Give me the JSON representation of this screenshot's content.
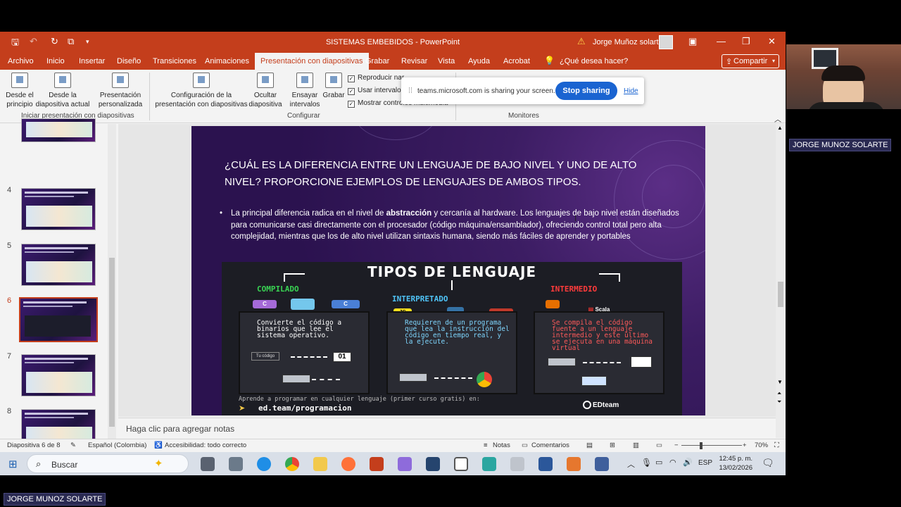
{
  "titlebar": {
    "title": "SISTEMAS EMBEBIDOS  -  PowerPoint",
    "user": "Jorge Muñoz solarte"
  },
  "menu": {
    "tabs": [
      "Archivo",
      "Inicio",
      "Insertar",
      "Diseño",
      "Transiciones",
      "Animaciones",
      "Presentación con diapositivas",
      "Grabar",
      "Revisar",
      "Vista",
      "Ayuda",
      "Acrobat",
      "¿Qué desea hacer?"
    ],
    "share": "Compartir"
  },
  "ribbon": {
    "desde_principio": "Desde el principio",
    "desde_actual": "Desde la diapositiva actual",
    "personalizada": "Presentación personalizada",
    "group_iniciar": "Iniciar presentación con diapositivas",
    "configuracion": "Configuración de la presentación con diapositivas",
    "ocultar": "Ocultar diapositiva",
    "ensayar": "Ensayar intervalos",
    "grabar": "Grabar",
    "chk_reproducir": "Reproducir nar",
    "chk_intervalos": "Usar intervalos",
    "chk_controles": "Mostrar controles multimedia",
    "group_configurar": "Configurar",
    "group_monitores": "Monitores"
  },
  "sharing": {
    "message": "teams.microsoft.com is sharing your screen.",
    "stop": "Stop sharing",
    "hide": "Hide"
  },
  "thumbnails": [
    "4",
    "5",
    "6",
    "7",
    "8"
  ],
  "slide": {
    "title": "¿CUÁL ES LA DIFERENCIA ENTRE UN LENGUAJE DE BAJO NIVEL Y UNO DE ALTO NIVEL? PROPORCIONE EJEMPLOS DE LENGUAJES DE AMBOS TIPOS.",
    "body_pre": "La principal diferencia radica en el nivel de ",
    "body_bold": "abstracción",
    "body_post": " y cercanía al hardware. Los lenguajes de bajo nivel están diseñados para comunicarse casi directamente con el procesador (código máquina/ensamblador), ofreciendo control total pero alta complejidad, mientras que los de alto nivel utilizan sintaxis humana, siendo más fáciles de aprender y portables"
  },
  "infographic": {
    "title": "TIPOS DE LENGUAJE",
    "compilado": {
      "title": "COMPILADO",
      "text": "Convierte el código a binarios que lee el sistema operativo.",
      "source_label": "Tu código",
      "binary": "01"
    },
    "interpretado": {
      "title": "INTERPRETADO",
      "text": "Requieren de un programa que lea la instrucción del código en tiempo real, y la ejecute.",
      "badge": "JS"
    },
    "intermedio": {
      "title": "INTERMEDIO",
      "text": "Se compila el código fuente a un lenguaje intermedio y este último se ejecuta en una máquina virtual",
      "badge": "Scala"
    },
    "footer": "Aprende a programar en cualquier lenguaje (primer curso gratis) en:",
    "url": "ed.team/programacion",
    "brand": "EDteam"
  },
  "notes_placeholder": "Haga clic para agregar notas",
  "status": {
    "slide": "Diapositiva 6 de 8",
    "language": "Español (Colombia)",
    "accessibility": "Accesibilidad: todo correcto",
    "notes": "Notas",
    "comments": "Comentarios",
    "zoom": "70%"
  },
  "taskbar": {
    "search": "Buscar",
    "lang": "ESP",
    "time": "12:45 p. m.",
    "date": "13/02/2026"
  },
  "participant": {
    "name_top": "JORGE MUNOZ SOLARTE",
    "name_bottom": "JORGE MUNOZ SOLARTE"
  },
  "colors": {
    "ppt_accent": "#c43e1c",
    "teams_blue": "#1a64d1",
    "compilado": "#39d353",
    "interpretado": "#4fc3f7",
    "intermedio": "#ff3b3b"
  }
}
